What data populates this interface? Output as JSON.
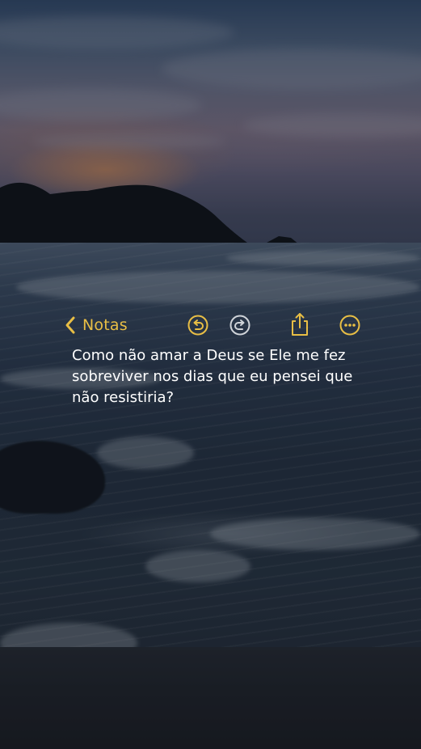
{
  "toolbar": {
    "back_label": "Notas",
    "accent_color": "#e8be45",
    "icons": [
      "chevron-left-icon",
      "undo-icon",
      "redo-icon",
      "share-icon",
      "more-icon"
    ]
  },
  "note": {
    "body": "Como não amar a Deus se Ele me fez sobreviver nos dias que eu pensei que não resistiria?"
  }
}
